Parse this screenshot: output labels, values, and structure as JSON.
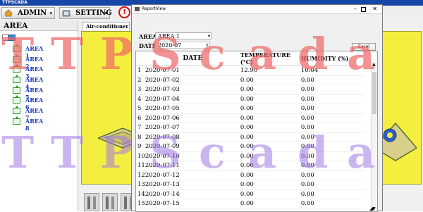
{
  "app": {
    "title": "TTPSCADA"
  },
  "toolbar": {
    "admin_label": "ADMIN",
    "setting_label": "SETTING",
    "alarm_icon_text": "!"
  },
  "tree": {
    "header": "AREA",
    "items": [
      {
        "label": "AREA 1"
      },
      {
        "label": "AREA 2"
      },
      {
        "label": "AREA 3"
      },
      {
        "label": "AREA 4"
      },
      {
        "label": "AREA 5"
      },
      {
        "label": "AREA 6"
      },
      {
        "label": "AREA 7"
      },
      {
        "label": "AREA 8"
      }
    ]
  },
  "content": {
    "tab_label": "Air-conditioner"
  },
  "report": {
    "window_title": "ReportView",
    "area_label": "AREA",
    "area_value": "AREA 1",
    "date_label": "DATE",
    "date_value": "2020-07",
    "excel_label": "Excel",
    "columns": [
      "DATE",
      "TEMPERATURE (°C)",
      "HUMIDITY (%)"
    ],
    "rows": [
      [
        "1",
        "2020-07-01",
        "12.90",
        "10.04"
      ],
      [
        "2",
        "2020-07-02",
        "0.00",
        "0.00"
      ],
      [
        "3",
        "2020-07-03",
        "0.00",
        "0.00"
      ],
      [
        "4",
        "2020-07-04",
        "0.00",
        "0.00"
      ],
      [
        "5",
        "2020-07-05",
        "0.00",
        "0.00"
      ],
      [
        "6",
        "2020-07-06",
        "0.00",
        "0.00"
      ],
      [
        "7",
        "2020-07-07",
        "0.00",
        "0.00"
      ],
      [
        "8",
        "2020-07-08",
        "0.00",
        "0.00"
      ],
      [
        "9",
        "2020-07-09",
        "0.00",
        "0.00"
      ],
      [
        "10",
        "2020-07-10",
        "0.00",
        "0.00"
      ],
      [
        "11",
        "2020-07-11",
        "0.00",
        "0.00"
      ],
      [
        "12",
        "2020-07-12",
        "0.00",
        "0.00"
      ],
      [
        "13",
        "2020-07-13",
        "0.00",
        "0.00"
      ],
      [
        "14",
        "2020-07-14",
        "0.00",
        "0.00"
      ],
      [
        "15",
        "2020-07-15",
        "0.00",
        "0.00"
      ]
    ]
  },
  "watermark": {
    "text": "TTPScada"
  },
  "colors": {
    "titlebar": "#1747a6",
    "panel_yellow": "#f4ef3f",
    "tree_label": "#1a37b8",
    "alarm_red": "#d01010"
  }
}
